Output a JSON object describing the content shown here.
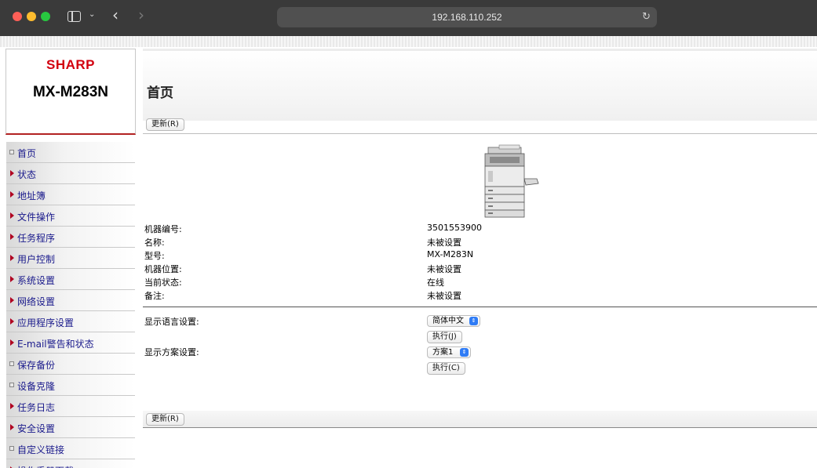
{
  "browser": {
    "url": "192.168.110.252"
  },
  "logo": {
    "brand": "SHARP",
    "model": "MX-M283N"
  },
  "nav": {
    "items": [
      {
        "label": "首页",
        "marker": "square"
      },
      {
        "label": "状态",
        "marker": "triangle"
      },
      {
        "label": "地址簿",
        "marker": "triangle"
      },
      {
        "label": "文件操作",
        "marker": "triangle"
      },
      {
        "label": "任务程序",
        "marker": "triangle"
      },
      {
        "label": "用户控制",
        "marker": "triangle"
      },
      {
        "label": "系统设置",
        "marker": "triangle"
      },
      {
        "label": "网络设置",
        "marker": "triangle"
      },
      {
        "label": "应用程序设置",
        "marker": "triangle"
      },
      {
        "label": "E-mail警告和状态",
        "marker": "triangle"
      },
      {
        "label": "保存备份",
        "marker": "square"
      },
      {
        "label": "设备克隆",
        "marker": "square"
      },
      {
        "label": "任务日志",
        "marker": "triangle"
      },
      {
        "label": "安全设置",
        "marker": "triangle"
      },
      {
        "label": "自定义链接",
        "marker": "square"
      },
      {
        "label": "操作手册下载",
        "marker": "triangle"
      }
    ]
  },
  "main": {
    "title": "首页",
    "refresh_label": "更新(R)",
    "info": [
      {
        "label": "机器编号:",
        "value": "3501553900"
      },
      {
        "label": "名称:",
        "value": "未被设置"
      },
      {
        "label": "型号:",
        "value": "MX-M283N"
      },
      {
        "label": "机器位置:",
        "value": "未被设置"
      },
      {
        "label": "当前状态:",
        "value": "在线"
      },
      {
        "label": "备注:",
        "value": "未被设置"
      }
    ],
    "language": {
      "label": "显示语言设置:",
      "selected": "简体中文",
      "execute_label": "执行(J)"
    },
    "scheme": {
      "label": "显示方案设置:",
      "selected": "方案1",
      "execute_label": "执行(C)"
    }
  }
}
